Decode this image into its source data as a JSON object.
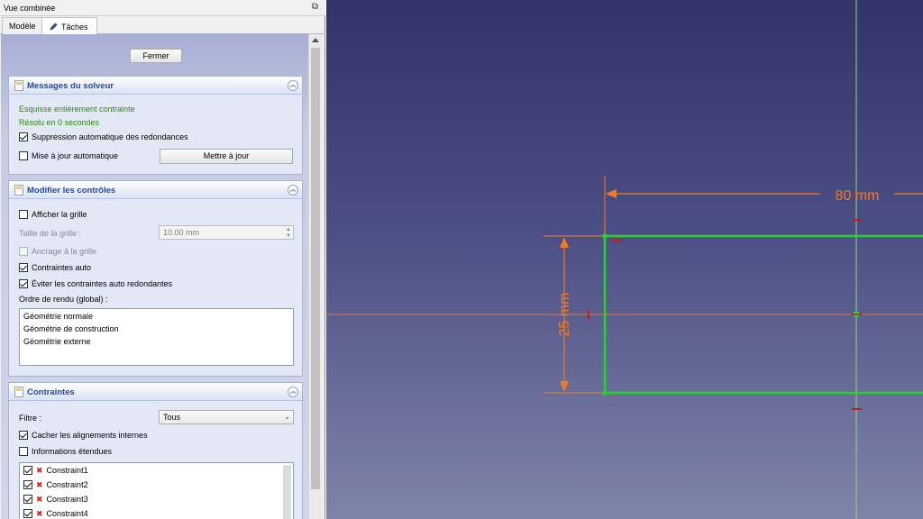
{
  "combo_view": {
    "title": "Vue combinée",
    "tabs": [
      {
        "label": "Modèle",
        "active": false
      },
      {
        "label": "Tâches",
        "active": true
      }
    ]
  },
  "task_panel": {
    "close_button": "Fermer",
    "solver_messages": {
      "title": "Messages du solveur",
      "status_constraint": "Esquisse entièrement contrainte",
      "status_time": "Résolu en 0 secondes",
      "auto_remove_redundants": {
        "label": "Suppression automatique des redondances",
        "checked": true
      },
      "auto_update": {
        "label": "Mise à jour automatique",
        "checked": false
      },
      "update_button": "Mettre à jour"
    },
    "edit_controls": {
      "title": "Modifier les contrôles",
      "show_grid": {
        "label": "Afficher la grille",
        "checked": false
      },
      "grid_size_label": "Taille de la grille :",
      "grid_size_value": "10.00 mm",
      "grid_snap": {
        "label": "Ancrage à la grille",
        "checked": false
      },
      "auto_constraints": {
        "label": "Contraintes auto",
        "checked": true
      },
      "avoid_redundant": {
        "label": "Éviter les contraintes auto redondantes",
        "checked": true
      },
      "render_order_label": "Ordre de rendu (global) :",
      "render_order_items": [
        "Géométrie normale",
        "Géométrie de construction",
        "Géométrie externe"
      ]
    },
    "constraints": {
      "title": "Contraintes",
      "filter_label": "Filtre :",
      "filter_value": "Tous",
      "hide_internal": {
        "label": "Cacher les alignements internes",
        "checked": true
      },
      "extended_info": {
        "label": "Informations étendues",
        "checked": false
      },
      "items": [
        {
          "label": "Constraint1",
          "checked": true
        },
        {
          "label": "Constraint2",
          "checked": true
        },
        {
          "label": "Constraint3",
          "checked": true
        },
        {
          "label": "Constraint4",
          "checked": true
        }
      ]
    }
  },
  "viewport": {
    "dim_horizontal": "80 mm",
    "dim_vertical": "25 mm",
    "colors": {
      "sketch_geometry": "#27d327",
      "dimension": "#f07a22",
      "axis": "#e8743a",
      "vertical_axis": "#7fe07f",
      "background_top": "#333369",
      "background_bottom": "#7f84a9"
    }
  }
}
